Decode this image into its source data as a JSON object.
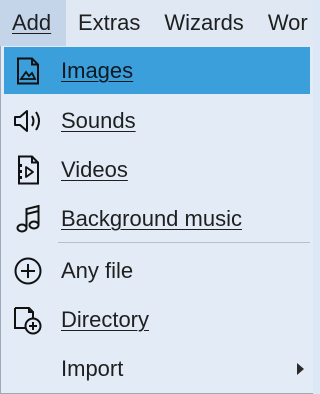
{
  "menubar": {
    "items": [
      {
        "label": "Add"
      },
      {
        "label": "Extras"
      },
      {
        "label": "Wizards"
      },
      {
        "label": "Wor"
      }
    ]
  },
  "menu": {
    "items": [
      {
        "label": "Images",
        "icon": "image-file-icon",
        "selected": true
      },
      {
        "label": "Sounds",
        "icon": "speaker-icon"
      },
      {
        "label": "Videos",
        "icon": "video-file-icon"
      },
      {
        "label": "Background music",
        "icon": "music-note-icon"
      },
      {
        "label": "Any file",
        "icon": "plus-circle-icon"
      },
      {
        "label": "Directory",
        "icon": "folder-add-icon"
      },
      {
        "label": "Import",
        "icon": "",
        "has_submenu": true
      }
    ]
  },
  "colors": {
    "selection": "#3a9fdb",
    "menu_background": "#e2ebf6",
    "menubar_active": "#c4d5ea"
  }
}
